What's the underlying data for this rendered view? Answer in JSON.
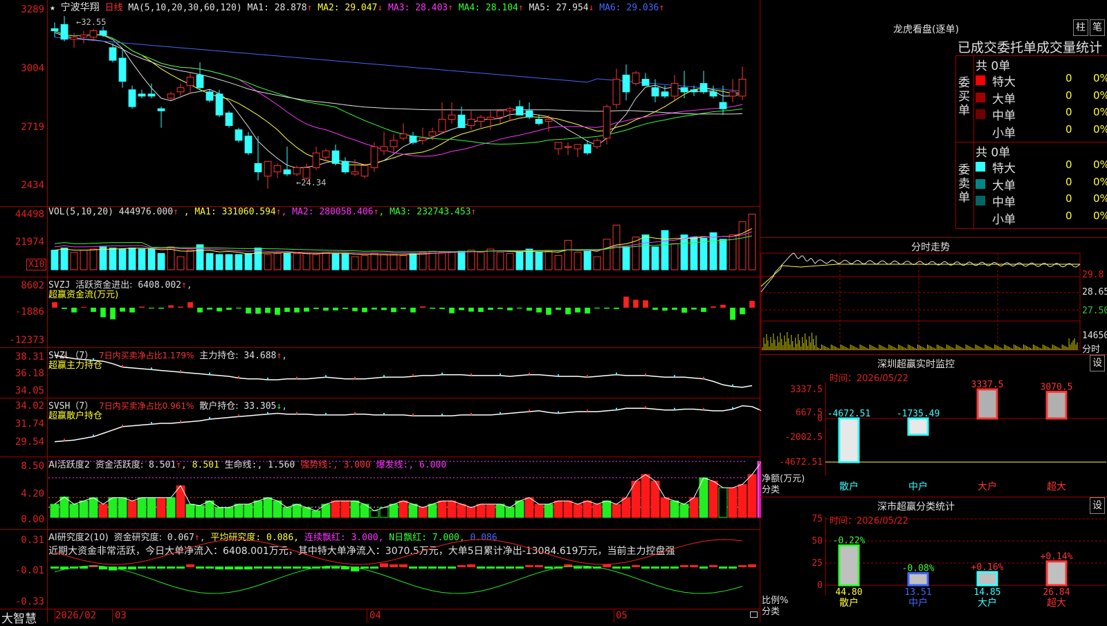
{
  "stock": {
    "star": "★",
    "name": "宁波华翔",
    "period": "日线"
  },
  "kline": {
    "ma_label": "MA(5,10,20,30,60,120)",
    "ma_values": [
      {
        "label": "MA1:",
        "value": "28.878",
        "arrow": "↑",
        "color": "#e0e0e0"
      },
      {
        "label": "MA2:",
        "value": "29.047",
        "arrow": "↓",
        "color": "#ffff33"
      },
      {
        "label": "MA3:",
        "value": "28.403",
        "arrow": "↑",
        "color": "#ff33ff"
      },
      {
        "label": "MA4:",
        "value": "28.104",
        "arrow": "↑",
        "color": "#33ff33"
      },
      {
        "label": "MA5:",
        "value": "27.954",
        "arrow": "↓",
        "color": "#e0e0e0"
      },
      {
        "label": "MA6:",
        "value": "29.036",
        "arrow": "↑",
        "color": "#4466ff"
      }
    ],
    "y_ticks": [
      "3289",
      "3004",
      "2719",
      "2434"
    ],
    "high_label": "32.55",
    "low_label": "24.34",
    "candles": [
      [
        31.9,
        32.2,
        31.5,
        31.8
      ],
      [
        32.1,
        32.5,
        31.3,
        31.4
      ],
      [
        31.4,
        31.7,
        31.0,
        31.5
      ],
      [
        31.5,
        31.8,
        31.2,
        31.6
      ],
      [
        31.5,
        31.9,
        31.3,
        31.8
      ],
      [
        31.8,
        32.0,
        31.5,
        31.6
      ],
      [
        31.0,
        31.2,
        30.3,
        30.4
      ],
      [
        30.5,
        30.9,
        29.1,
        29.4
      ],
      [
        29.0,
        29.2,
        28.1,
        28.2
      ],
      [
        28.8,
        29.0,
        28.6,
        28.7
      ],
      [
        28.8,
        29.3,
        28.6,
        28.7
      ],
      [
        28.1,
        28.2,
        27.2,
        28.0
      ],
      [
        28.6,
        28.9,
        28.5,
        28.8
      ],
      [
        28.9,
        29.3,
        28.7,
        29.1
      ],
      [
        29.2,
        29.8,
        28.8,
        29.6
      ],
      [
        29.7,
        30.3,
        29.0,
        29.1
      ],
      [
        28.9,
        29.0,
        28.4,
        28.5
      ],
      [
        28.8,
        29.0,
        27.7,
        27.8
      ],
      [
        27.9,
        28.0,
        27.2,
        27.3
      ],
      [
        27.1,
        27.2,
        26.5,
        26.6
      ],
      [
        26.8,
        27.0,
        25.9,
        26.0
      ],
      [
        25.5,
        26.8,
        24.7,
        25.1
      ],
      [
        24.9,
        25.4,
        24.3,
        25.6
      ],
      [
        25.1,
        25.5,
        24.8,
        25.4
      ],
      [
        25.2,
        26.3,
        24.9,
        25.0
      ],
      [
        25.0,
        25.4,
        24.9,
        25.3
      ],
      [
        24.8,
        25.5,
        24.7,
        25.3
      ],
      [
        25.3,
        26.3,
        25.2,
        26.0
      ],
      [
        25.8,
        26.2,
        25.6,
        26.1
      ],
      [
        26.1,
        26.4,
        25.4,
        25.5
      ],
      [
        25.6,
        25.8,
        25.0,
        25.1
      ],
      [
        25.0,
        25.7,
        24.9,
        25.1
      ],
      [
        24.9,
        25.4,
        24.8,
        25.4
      ],
      [
        25.3,
        26.5,
        25.1,
        26.3
      ],
      [
        26.1,
        27.0,
        25.9,
        26.3
      ],
      [
        26.3,
        26.9,
        26.0,
        26.6
      ],
      [
        26.7,
        27.4,
        26.6,
        26.9
      ],
      [
        26.8,
        27.0,
        26.4,
        26.5
      ],
      [
        26.6,
        27.2,
        26.4,
        26.7
      ],
      [
        26.8,
        27.2,
        26.6,
        27.0
      ],
      [
        27.0,
        28.4,
        26.9,
        27.6
      ],
      [
        27.6,
        28.4,
        27.4,
        27.8
      ],
      [
        27.8,
        28.2,
        27.4,
        27.2
      ],
      [
        27.3,
        28.0,
        27.1,
        27.6
      ],
      [
        27.5,
        27.8,
        27.2,
        27.7
      ],
      [
        27.6,
        28.0,
        27.1,
        27.7
      ],
      [
        27.7,
        28.1,
        27.4,
        28.0
      ],
      [
        28.0,
        28.2,
        27.5,
        28.1
      ],
      [
        28.2,
        28.5,
        27.8,
        27.8
      ],
      [
        28.0,
        28.4,
        27.6,
        27.7
      ],
      [
        27.6,
        27.8,
        27.3,
        27.4
      ],
      [
        27.5,
        27.8,
        27.0,
        27.6
      ],
      [
        26.2,
        26.5,
        25.9,
        26.5
      ],
      [
        26.3,
        26.5,
        25.9,
        26.3
      ],
      [
        26.2,
        26.4,
        25.8,
        26.4
      ],
      [
        26.4,
        26.6,
        25.9,
        26.0
      ],
      [
        26.3,
        26.7,
        26.2,
        26.6
      ],
      [
        26.7,
        28.3,
        26.4,
        28.2
      ],
      [
        28.3,
        30.0,
        28.1,
        29.5
      ],
      [
        29.7,
        30.2,
        28.5,
        28.9
      ],
      [
        29.3,
        29.9,
        29.2,
        29.8
      ],
      [
        29.5,
        29.8,
        29.2,
        29.2
      ],
      [
        29.1,
        29.5,
        28.4,
        28.7
      ],
      [
        28.9,
        29.2,
        28.6,
        28.7
      ],
      [
        28.7,
        29.7,
        28.5,
        29.3
      ],
      [
        29.1,
        29.9,
        28.6,
        28.9
      ],
      [
        29.0,
        29.2,
        28.7,
        28.9
      ],
      [
        29.3,
        29.9,
        28.8,
        28.9
      ],
      [
        28.9,
        29.2,
        28.6,
        28.7
      ],
      [
        28.4,
        29.2,
        27.8,
        28.1
      ],
      [
        28.7,
        29.5,
        28.4,
        28.9
      ],
      [
        28.7,
        30.1,
        28.5,
        29.5
      ]
    ]
  },
  "vol": {
    "title": "VOL(5,10,20)",
    "value": "444976.000",
    "arrow": "↑",
    "ma": [
      {
        "label": "MA1:",
        "value": "331060.594",
        "arrow": "↑",
        "color": "#ffff33"
      },
      {
        "label": "MA2:",
        "value": "280058.406",
        "arrow": "↑",
        "color": "#ff33ff"
      },
      {
        "label": "MA3:",
        "value": "232743.453",
        "arrow": "↑",
        "color": "#33ff33"
      }
    ],
    "y_ticks": [
      "44498",
      "21974"
    ],
    "unit": "X10",
    "values": [
      18,
      20,
      16,
      18,
      19,
      21,
      20,
      19,
      20,
      19,
      19,
      15,
      21,
      12,
      18,
      23,
      15,
      14,
      14,
      14,
      15,
      20,
      14,
      15,
      15,
      15,
      15,
      14,
      16,
      15,
      15,
      12,
      13,
      15,
      14,
      14,
      13,
      15,
      16,
      17,
      16,
      16,
      17,
      18,
      16,
      19,
      16,
      15,
      16,
      19,
      16,
      17,
      13,
      27,
      16,
      17,
      12,
      28,
      41,
      21,
      30,
      32,
      21,
      36,
      24,
      32,
      30,
      29,
      34,
      28,
      32,
      44,
      51
    ]
  },
  "svzj": {
    "title": "SVZJ",
    "label": "活跃资金进出:",
    "value": "6408.002",
    "arrow": "↑",
    "sub": "超赢资金流(万元)",
    "y_ticks": [
      "8602",
      "-1886",
      "-12373"
    ],
    "values": [
      2100,
      -500,
      -1800,
      300,
      -1600,
      -3600,
      -4400,
      -1500,
      -1800,
      400,
      -300,
      -400,
      900,
      400,
      2100,
      -1800,
      -700,
      -1400,
      -800,
      -300,
      -2200,
      -2300,
      -2000,
      -2700,
      -1600,
      -1800,
      -1500,
      -500,
      -1100,
      -1000,
      -500,
      -1300,
      -1700,
      -700,
      -900,
      -1700,
      -500,
      -1800,
      500,
      -400,
      -500,
      -2100,
      -900,
      -1500,
      -1600,
      -800,
      -500,
      -1000,
      -300,
      -1100,
      -1800,
      -2700,
      -800,
      -2500,
      -1800,
      -2200,
      -300,
      -400,
      -500,
      4200,
      3000,
      2800,
      -800,
      -1100,
      -800,
      -1900,
      -700,
      -1600,
      500,
      1100,
      -4600,
      -2500,
      2600
    ]
  },
  "svzl": {
    "title": "SVZL（7）",
    "pct_label": "7日内买卖净占比1.179%",
    "label": "主力持仓:",
    "value": "34.688",
    "arrow": "↑",
    "sub": "超赢主力持仓",
    "y_ticks": [
      "38.31",
      "36.18",
      "34.05"
    ],
    "values": [
      38.3,
      38.1,
      37.9,
      37.8,
      37.7,
      37.6,
      37.3,
      36.9,
      36.8,
      36.7,
      36.6,
      36.5,
      36.4,
      36.3,
      36.2,
      36.1,
      36.0,
      35.9,
      35.8,
      35.6,
      35.5,
      35.5,
      35.4,
      35.4,
      35.5,
      35.5,
      35.5,
      35.6,
      35.7,
      35.6,
      35.5,
      35.5,
      35.5,
      35.6,
      35.7,
      35.7,
      35.7,
      35.8,
      35.9,
      35.9,
      36.0,
      36.0,
      36.0,
      35.9,
      35.9,
      35.9,
      35.9,
      35.8,
      35.9,
      36.0,
      36.0,
      35.9,
      35.8,
      35.8,
      35.8,
      35.7,
      35.8,
      35.9,
      36.0,
      35.9,
      35.9,
      35.9,
      35.8,
      35.7,
      35.7,
      35.7,
      35.6,
      35.5,
      35.2,
      34.8,
      34.6,
      34.5,
      34.7
    ]
  },
  "svsh": {
    "title": "SVSH（7）",
    "pct_label": "7日内买卖净占比0.961%",
    "label": "散户持仓:",
    "value": "33.305",
    "arrow": "↓",
    "sub": "超赢散户持仓",
    "y_ticks": [
      "34.02",
      "31.74",
      "29.54"
    ],
    "values": [
      29.6,
      29.7,
      29.8,
      30.0,
      30.2,
      30.6,
      31.0,
      31.4,
      31.5,
      31.6,
      31.7,
      31.8,
      31.8,
      31.9,
      32.0,
      32.1,
      32.3,
      32.4,
      32.5,
      32.6,
      32.7,
      32.8,
      32.9,
      33.0,
      32.9,
      32.9,
      32.9,
      32.8,
      32.8,
      32.8,
      32.8,
      32.9,
      32.9,
      32.8,
      32.8,
      32.8,
      32.8,
      32.7,
      32.7,
      32.7,
      32.7,
      32.7,
      32.8,
      32.8,
      32.8,
      32.8,
      32.9,
      33.0,
      33.1,
      33.2,
      33.3,
      33.1,
      33.0,
      33.1,
      33.2,
      33.2,
      33.2,
      33.3,
      33.4,
      33.6,
      33.6,
      33.6,
      33.5,
      33.4,
      33.4,
      33.5,
      33.5,
      33.4,
      33.3,
      33.3,
      33.5,
      33.9,
      33.8,
      33.3
    ]
  },
  "ai1": {
    "title": "AI活跃度2",
    "label": "资金活跃度:",
    "value": "8.501",
    "arrow": "↑",
    "items": [
      {
        "text": "8.501",
        "color": "#ffff33"
      },
      {
        "text": "生命线:",
        "color": "#e0e0e0"
      },
      {
        "text": "1.560",
        "color": "#e0e0e0"
      },
      {
        "text": "强势线:",
        "color": "#ff3333"
      },
      {
        "text": "3.000",
        "color": "#ff3333"
      },
      {
        "text": "爆发线:",
        "color": "#ff33ff"
      },
      {
        "text": "6.000",
        "color": "#ff33ff"
      }
    ],
    "y_ticks": [
      "8.50",
      "4.20",
      "0.00"
    ],
    "values": [
      2.0,
      3.1,
      2.0,
      2.5,
      3.0,
      2.0,
      3.0,
      3.0,
      2.5,
      3.0,
      3.0,
      3.0,
      3.0,
      4.8,
      2.0,
      1.8,
      2.5,
      1.5,
      1.5,
      2.0,
      2.0,
      2.5,
      3.0,
      2.5,
      1.5,
      2.0,
      1.5,
      1.0,
      2.0,
      2.5,
      2.5,
      2.5,
      2.0,
      1.0,
      1.5,
      2.0,
      2.5,
      2.0,
      1.5,
      2.0,
      2.5,
      2.5,
      2.0,
      1.5,
      2.0,
      2.0,
      2.0,
      1.5,
      2.5,
      3.0,
      2.0,
      2.0,
      2.5,
      2.5,
      2.0,
      2.5,
      2.0,
      2.5,
      2.0,
      3.0,
      5.5,
      6.5,
      5.5,
      3.0,
      2.5,
      2.0,
      3.0,
      6.0,
      5.5,
      4.5,
      4.5,
      5.0,
      6.5,
      8.5
    ],
    "colors": [
      "g",
      "g",
      "g",
      "g",
      "g",
      "r",
      "g",
      "g",
      "r",
      "g",
      "g",
      "r",
      "g",
      "r",
      "g",
      "g",
      "g",
      "g",
      "g",
      "g",
      "g",
      "g",
      "g",
      "g",
      "g",
      "g",
      "g",
      "g",
      "g",
      "r",
      "r",
      "g",
      "g",
      "go",
      "go",
      "g",
      "r",
      "g",
      "r",
      "g",
      "r",
      "r",
      "r",
      "r",
      "r",
      "r",
      "g",
      "g",
      "g",
      "r",
      "r",
      "g",
      "r",
      "r",
      "r",
      "r",
      "r",
      "g",
      "r",
      "r",
      "r",
      "r",
      "r",
      "r",
      "g",
      "g",
      "r",
      "g",
      "r",
      "go",
      "r",
      "r",
      "r",
      "m"
    ]
  },
  "ai2": {
    "title": "AI研究度2(10)",
    "label": "资金研究度:",
    "value": "0.067",
    "arrow": "↑",
    "items": [
      {
        "text": "平均研究度:",
        "color": "#ffff33"
      },
      {
        "text": "0.086",
        "color": "#ffff33"
      },
      {
        "text": "连续飘红:",
        "color": "#ff33ff"
      },
      {
        "text": "3.000",
        "color": "#ff33ff"
      },
      {
        "text": "N日飘红:",
        "color": "#33ff33"
      },
      {
        "text": "7.000",
        "color": "#33ff33"
      },
      {
        "text": "0.086",
        "color": "#4466ff"
      }
    ],
    "y_ticks": [
      "0.31",
      "-0.01",
      "-0.33"
    ],
    "note": "近期大资金非常活跃，今日大单净流入：6408.001万元，其中特大单净流入：3070.5万元，大单5日累计净出-13084.619万元，当前主力控盘强",
    "values": [
      -0.01,
      -0.04,
      -0.01,
      -0.01,
      0.01,
      -0.04,
      -0.05,
      -0.04,
      -0.04,
      -0.01,
      -0.02,
      -0.01,
      -0.01,
      -0.01,
      0.02,
      -0.01,
      -0.01,
      -0.04,
      -0.04,
      -0.04,
      -0.04,
      -0.02,
      -0.01,
      -0.01,
      -0.01,
      -0.01,
      -0.01,
      -0.01,
      -0.01,
      -0.01,
      -0.04,
      -0.06,
      -0.01,
      -0.02,
      0.03,
      0.02,
      0.02,
      -0.01,
      -0.01,
      -0.01,
      -0.01,
      -0.01,
      0.01,
      0.02,
      -0.01,
      -0.01,
      -0.01,
      -0.01,
      -0.01,
      0.01,
      0.01,
      -0.02,
      -0.01,
      0.02,
      -0.01,
      -0.01,
      -0.01,
      0.02,
      -0.01,
      -0.01,
      0.01,
      -0.01,
      -0.01,
      -0.01,
      -0.01,
      0.01,
      0.01,
      -0.01,
      0.01,
      -0.01,
      -0.01,
      0.01,
      0.02
    ]
  },
  "xaxis": {
    "brand": "大智慧",
    "labels": [
      "2026/02",
      "03",
      "04",
      "05"
    ]
  },
  "longhu": {
    "title": "龙虎看盘(逐单)",
    "btn1": "柱",
    "btn2": "笔",
    "header": "已成交委托单成交量统计",
    "buy": {
      "side": "委买单",
      "total": "共 0单",
      "rows": [
        {
          "label": "特大",
          "n": "0",
          "p": "0%",
          "color": "#ff0000"
        },
        {
          "label": "大单",
          "n": "0",
          "p": "0%",
          "color": "#a00000"
        },
        {
          "label": "中单",
          "n": "0",
          "p": "0%",
          "color": "#700000"
        },
        {
          "label": "小单",
          "n": "0",
          "p": "0%",
          "color": "#000000"
        }
      ]
    },
    "sell": {
      "side": "委卖单",
      "total": "共 0单",
      "rows": [
        {
          "label": "特大",
          "n": "0",
          "p": "0%",
          "color": "#33ffff"
        },
        {
          "label": "大单",
          "n": "0",
          "p": "0%",
          "color": "#008888"
        },
        {
          "label": "中单",
          "n": "0",
          "p": "0%",
          "color": "#006666"
        },
        {
          "label": "小单",
          "n": "0",
          "p": "0%",
          "color": "#000000"
        }
      ]
    }
  },
  "fenshi": {
    "title": "分时走势",
    "y_ticks": [
      "29.8",
      "28.65",
      "27.50"
    ],
    "vol_max": "14650",
    "vol_label": "分时"
  },
  "monitor": {
    "title": "深圳超赢实时监控",
    "settings": "设",
    "time_label": "时间：",
    "date": "2026/05/22",
    "y_ticks": [
      "3337.5",
      "667.5",
      "0",
      "-2002.5",
      "-4672.51"
    ],
    "ylabel": "净额(万元)",
    "xlabel": "分类",
    "categories": [
      "散户",
      "中户",
      "大户",
      "超大"
    ],
    "values": [
      -4672.51,
      -1735.49,
      3337.5,
      3070.5
    ],
    "value_labels": [
      "-4672.51",
      "-1735.49",
      "3337.5",
      "3070.5"
    ]
  },
  "classify": {
    "title": "深市超赢分类统计",
    "settings": "设",
    "time_label": "时间：",
    "date": "2026/05/22",
    "y_ticks": [
      "75",
      "50",
      "25",
      "0"
    ],
    "ylabel": "比例%",
    "xlabel": "分类",
    "categories": [
      "散户",
      "中户",
      "大户",
      "超大"
    ],
    "values": [
      44.8,
      13.51,
      14.85,
      26.84
    ],
    "change": [
      "-0.22%",
      "-0.08%",
      "+0.16%",
      "+0.14%"
    ]
  }
}
